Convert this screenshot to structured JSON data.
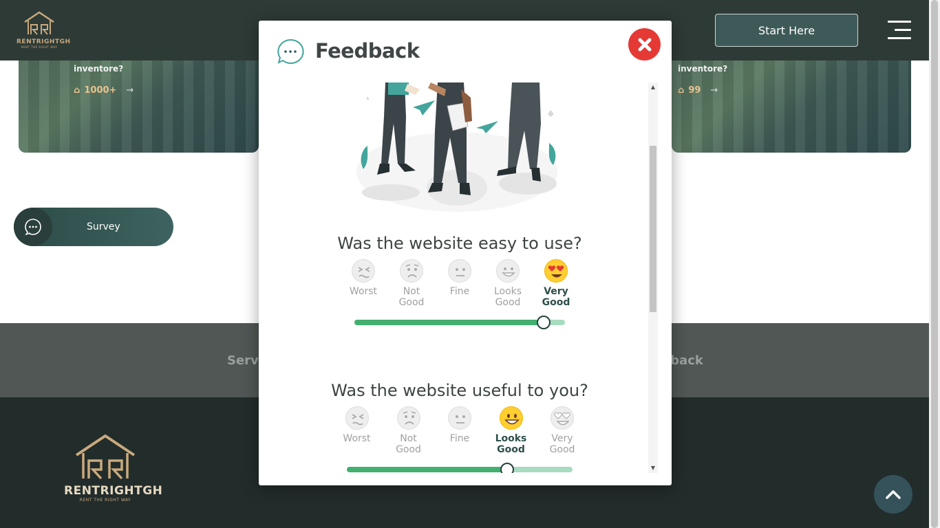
{
  "header": {
    "brand": "RENTRIGHTGH",
    "tagline": "RENT THE RIGHT WAY",
    "start_button": "Start Here",
    "menu_icon": "hamburger-icon"
  },
  "cards": [
    {
      "text": "inventore?",
      "count": "1000+",
      "arrow": "→"
    },
    {
      "text": "inventore?",
      "count": "99",
      "arrow": "→"
    }
  ],
  "survey": {
    "label": "Survey",
    "icon": "chat-icon"
  },
  "band": {
    "left_text": "Servi",
    "right_text": "lback"
  },
  "footer": {
    "brand": "RENTRIGHTGH",
    "tagline": "RENT THE RIGHT WAY",
    "to_top_icon": "chevron-up-icon"
  },
  "modal": {
    "title": "Feedback",
    "close_icon": "close-icon",
    "questions": [
      {
        "text": "Was the website easy to use?",
        "options": [
          {
            "l1": "Worst",
            "l2": ""
          },
          {
            "l1": "Not",
            "l2": "Good"
          },
          {
            "l1": "Fine",
            "l2": ""
          },
          {
            "l1": "Looks",
            "l2": "Good"
          },
          {
            "l1": "Very",
            "l2": "Good"
          }
        ],
        "selected": "Very Good",
        "slider_value": 0.9
      },
      {
        "text": "Was the website useful to you?",
        "options": [
          {
            "l1": "Worst",
            "l2": ""
          },
          {
            "l1": "Not",
            "l2": "Good"
          },
          {
            "l1": "Fine",
            "l2": ""
          },
          {
            "l1": "Looks",
            "l2": "Good"
          },
          {
            "l1": "Very",
            "l2": "Good"
          }
        ],
        "selected": "Looks Good",
        "slider_value": 0.71
      }
    ]
  },
  "colors": {
    "header_bg": "#2e3a36",
    "accent_green": "#43b06f",
    "close_red": "#e53935",
    "gold": "#c9a97d"
  }
}
